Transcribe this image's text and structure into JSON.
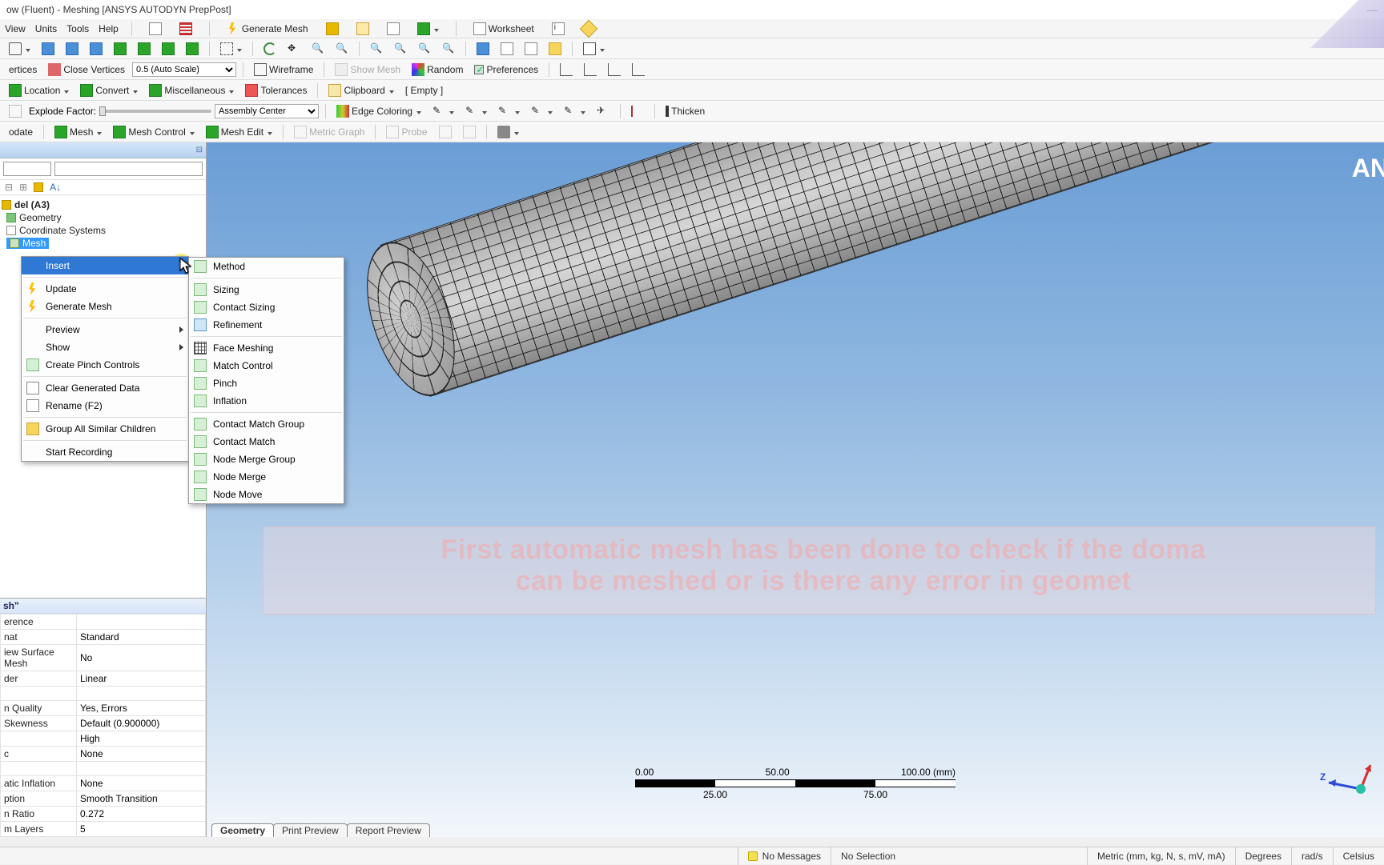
{
  "title": "ow (Fluent) - Meshing [ANSYS AUTODYN PrepPost]",
  "watermark_brand": "AN",
  "menubar": {
    "items": [
      "View",
      "Units",
      "Tools",
      "Help"
    ]
  },
  "toolbar_top": {
    "generate_mesh": "Generate Mesh",
    "worksheet": "Worksheet"
  },
  "toolbar_row3": {
    "close_vertices": "Close Vertices",
    "scale_value": "0.5 (Auto Scale)",
    "wireframe": "Wireframe",
    "show_mesh": "Show Mesh",
    "random": "Random",
    "preferences": "Preferences",
    "vertices": "ertices"
  },
  "toolbar_row4": {
    "location": "Location",
    "convert": "Convert",
    "misc": "Miscellaneous",
    "tolerances": "Tolerances",
    "clipboard": "Clipboard",
    "empty": "[ Empty ]"
  },
  "toolbar_row5": {
    "explode_label": "Explode Factor:",
    "assembly_center": "Assembly Center",
    "edge_coloring": "Edge Coloring",
    "thicken": "Thicken"
  },
  "toolbar_row6": {
    "update": "odate",
    "mesh": "Mesh",
    "mesh_control": "Mesh Control",
    "mesh_edit": "Mesh Edit",
    "metric_graph": "Metric Graph",
    "probe": "Probe"
  },
  "tree": {
    "root": "del (A3)",
    "geometry": "Geometry",
    "coord": "Coordinate Systems",
    "mesh": "Mesh"
  },
  "context_menu": {
    "insert": "Insert",
    "update": "Update",
    "generate_mesh": "Generate Mesh",
    "preview": "Preview",
    "show": "Show",
    "create_pinch": "Create Pinch Controls",
    "clear_generated": "Clear Generated Data",
    "rename": "Rename (F2)",
    "group_similar": "Group All Similar Children",
    "start_recording": "Start Recording"
  },
  "submenu_insert": {
    "method": "Method",
    "sizing": "Sizing",
    "contact_sizing": "Contact Sizing",
    "refinement": "Refinement",
    "face_meshing": "Face Meshing",
    "match_control": "Match Control",
    "pinch": "Pinch",
    "inflation": "Inflation",
    "contact_match_group": "Contact Match Group",
    "contact_match": "Contact Match",
    "node_merge_group": "Node Merge Group",
    "node_merge": "Node Merge",
    "node_move": "Node Move"
  },
  "details": {
    "header": "sh\"",
    "rows": [
      [
        "erence",
        ""
      ],
      [
        "nat",
        "Standard"
      ],
      [
        "iew Surface Mesh",
        "No"
      ],
      [
        "der",
        "Linear"
      ],
      [
        "",
        ""
      ],
      [
        "n Quality",
        "Yes, Errors"
      ],
      [
        "Skewness",
        "Default (0.900000)"
      ],
      [
        "",
        "High"
      ],
      [
        "c",
        "None"
      ],
      [
        "",
        ""
      ],
      [
        "atic Inflation",
        "None"
      ],
      [
        "ption",
        "Smooth Transition"
      ],
      [
        "n Ratio",
        "0.272"
      ],
      [
        "m Layers",
        "5"
      ]
    ]
  },
  "scale_bar": {
    "ticks_top": [
      "0.00",
      "50.00",
      "100.00 (mm)"
    ],
    "ticks_bot": [
      "25.00",
      "75.00"
    ]
  },
  "view_tabs": {
    "geometry": "Geometry",
    "print_preview": "Print Preview",
    "report_preview": "Report Preview"
  },
  "overlay": "First automatic mesh has been done to check if the doma\ncan be meshed or is there any error in geomet",
  "triad_labels": {
    "z": "Z"
  },
  "status": {
    "messages": "No Messages",
    "selection": "No Selection",
    "units": "Metric (mm, kg, N, s, mV, mA)",
    "degrees": "Degrees",
    "rads": "rad/s",
    "temp": "Celsius"
  }
}
